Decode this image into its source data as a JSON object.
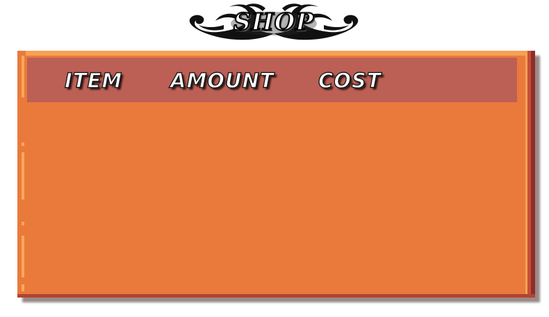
{
  "shop": {
    "title": "SHOP",
    "title_ornament_icon": "ornate-swirl-icon",
    "columns": {
      "item": "ITEM",
      "amount": "AMOUNT",
      "cost": "COST"
    },
    "items": []
  },
  "colors": {
    "panel": "#e97a3c",
    "panel_highlight": "#f6a155",
    "panel_dark": "#8d2f27",
    "header_bar": "#bc5f55",
    "header_text": "#ffffff",
    "ornament": "#111111"
  }
}
